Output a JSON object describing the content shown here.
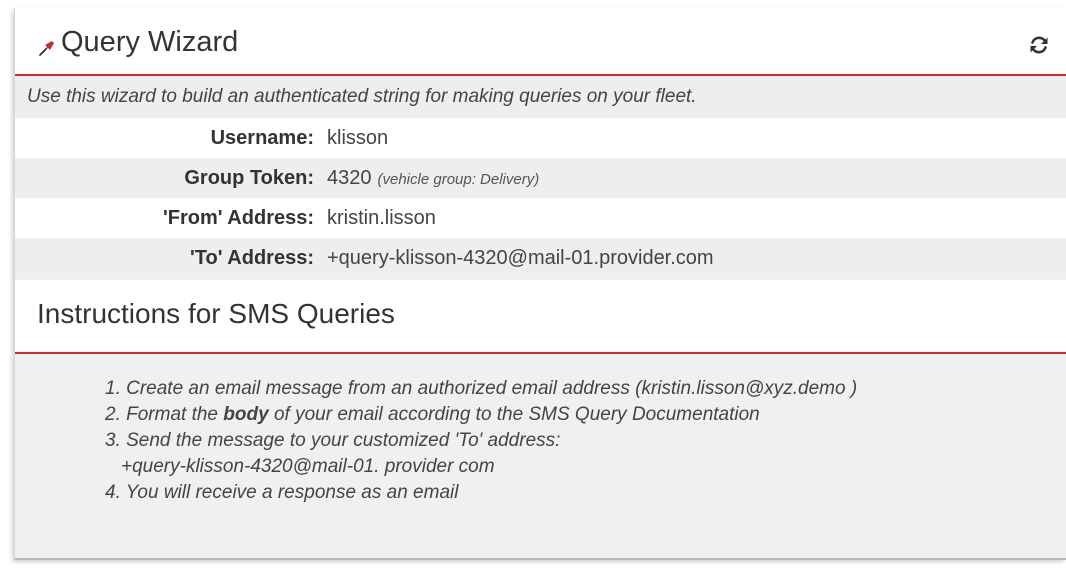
{
  "widget": {
    "title": "Query Wizard",
    "intro": "Use this wizard to build an authenticated string for making queries on your fleet."
  },
  "fields": [
    {
      "label": "Username:",
      "value": "klisson",
      "note": ""
    },
    {
      "label": "Group Token:",
      "value": "4320",
      "note": "(vehicle group: Delivery)"
    },
    {
      "label": "'From' Address:",
      "value": "kristin.lisson",
      "note": ""
    },
    {
      "label": "'To' Address:",
      "value": "+query-klisson-4320@mail-01.provider.com",
      "note": ""
    }
  ],
  "instructions": {
    "title": "Instructions for SMS Queries",
    "step1": "1. Create an email message from an authorized email address (kristin.lisson@xyz.demo )",
    "step2_prefix": "2. Format the ",
    "step2_bold": "body",
    "step2_suffix": " of your email according to the SMS Query Documentation",
    "step3": "3. Send the message to your customized 'To' address:",
    "step3_address": "+query-klisson-4320@mail-01. provider com",
    "step4": "4. You will receive a response as an email"
  },
  "icons": {
    "pin": "pushpin-icon",
    "refresh": "refresh-icon"
  },
  "colors": {
    "accent": "#d62b2b",
    "panel_bg": "#f0f0f0"
  }
}
